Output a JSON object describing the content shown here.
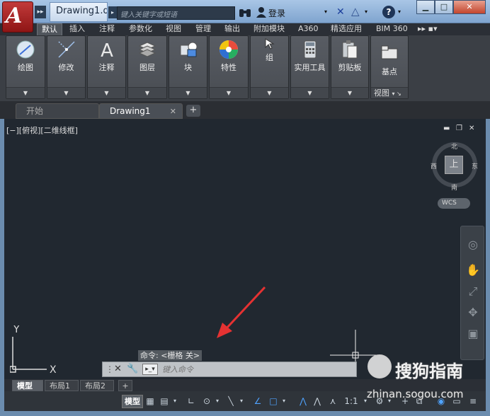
{
  "titlebar": {
    "doc_title": "Drawing1.d...",
    "search_placeholder": "键入关键字或短语",
    "signin_label": "登录",
    "help_label": "?"
  },
  "ribbon": {
    "tabs": [
      "默认",
      "插入",
      "注释",
      "参数化",
      "视图",
      "管理",
      "输出",
      "附加模块",
      "A360",
      "精选应用",
      "BIM 360",
      "▸▸ ▪▾"
    ],
    "active_tab": "默认",
    "panels": [
      {
        "label": "绘图",
        "icon": "draw-icon"
      },
      {
        "label": "修改",
        "icon": "modify-icon"
      },
      {
        "label": "注释",
        "icon": "annotation-icon"
      },
      {
        "label": "图层",
        "icon": "layers-icon"
      },
      {
        "label": "块",
        "icon": "block-icon"
      },
      {
        "label": "特性",
        "icon": "properties-icon"
      },
      {
        "label": "组",
        "icon": "group-icon"
      },
      {
        "label": "实用工具",
        "icon": "utilities-icon"
      },
      {
        "label": "剪贴板",
        "icon": "clipboard-icon"
      },
      {
        "label": "基点",
        "icon": "base-point-icon",
        "footer": "视图"
      }
    ]
  },
  "file_tabs": [
    {
      "label": "开始"
    },
    {
      "label": "Drawing1",
      "active": true
    }
  ],
  "viewport": {
    "label": "[−][俯视][二维线框]",
    "viewcube": {
      "north": "北",
      "south": "南",
      "east": "东",
      "west": "西",
      "center": "上"
    },
    "wcs_label": "WCS",
    "ucs_x": "X",
    "ucs_y": "Y"
  },
  "command": {
    "history": "命令: <栅格 关>",
    "placeholder": "键入命令"
  },
  "layout_tabs": [
    "模型",
    "布局1",
    "布局2",
    "+"
  ],
  "statusbar": {
    "model": "模型",
    "scale": "1:1"
  },
  "watermark": {
    "brand": "搜狗指南",
    "url": "zhinan.sogou.com"
  },
  "colors": {
    "canvas": "#212830",
    "ribbon": "#3b3f45",
    "accent": "#4fa3ff",
    "arrow": "#e53232"
  }
}
